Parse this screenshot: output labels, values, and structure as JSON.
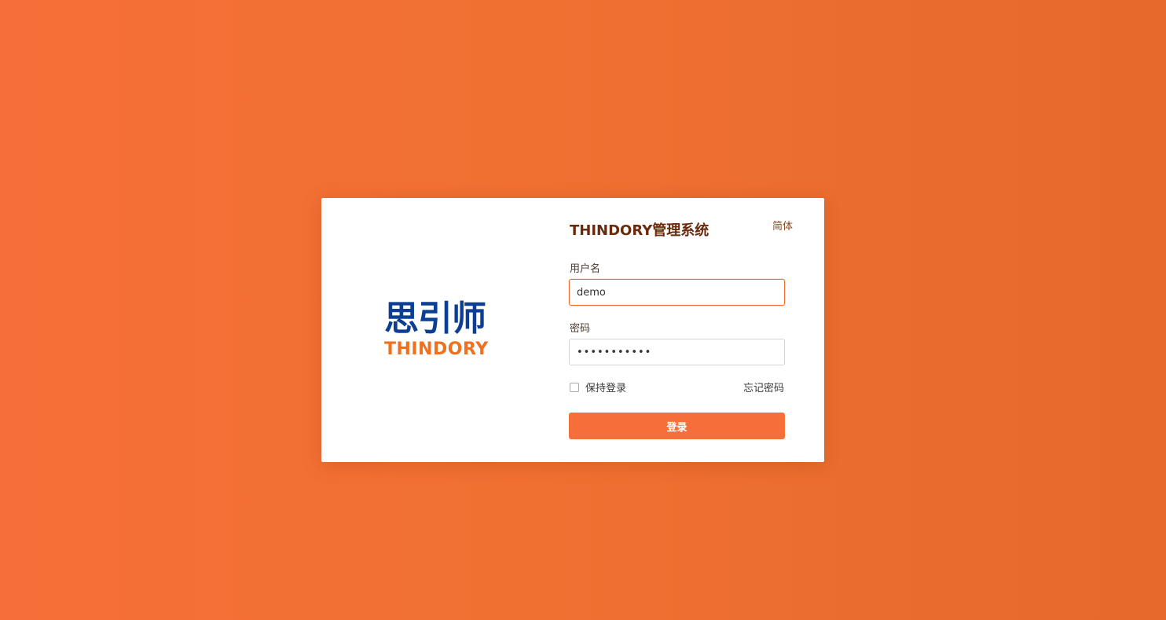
{
  "app": {
    "title": "THINDORY管理系统",
    "language": "简体"
  },
  "logo": {
    "cn_text": "思引师",
    "en_text": "THINDORY",
    "colors": {
      "cn": "#0c3f94",
      "en": "#f2701c"
    }
  },
  "form": {
    "username_label": "用户名",
    "username_value": "demo",
    "password_label": "密码",
    "password_value": "•••••••••••",
    "remember_label": "保持登录",
    "remember_checked": false,
    "forgot_label": "忘记密码",
    "submit_label": "登录"
  },
  "colors": {
    "background": "#f07032",
    "accent": "#f66f3a",
    "title": "#6a2a0c"
  }
}
